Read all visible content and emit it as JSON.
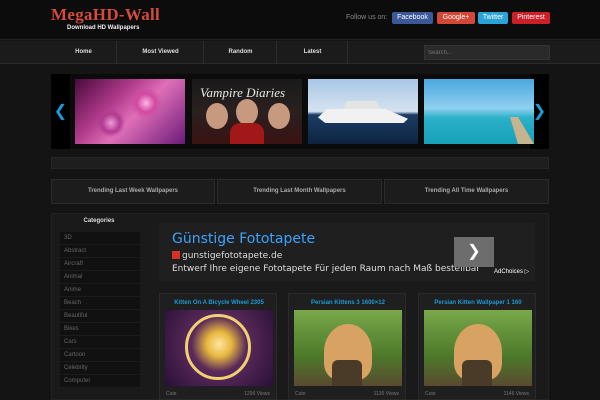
{
  "header": {
    "logo": "MegaHD-Wall",
    "tagline": "Download HD Wallpapers",
    "follow_label": "Follow us on:",
    "social": [
      "Facebook",
      "Google+",
      "Twitter",
      "Pinterest"
    ]
  },
  "nav": {
    "items": [
      "Home",
      "Most Viewed",
      "Random",
      "Latest"
    ],
    "search_placeholder": "Search..."
  },
  "slider": {
    "prev": "❮",
    "next": "❯",
    "slides": [
      {
        "caption": ""
      },
      {
        "caption": "Vampire Diaries"
      },
      {
        "caption": ""
      },
      {
        "caption": ""
      }
    ]
  },
  "trending": [
    "Trending Last Week Wallpapers",
    "Trending Last Month Wallpapers",
    "Trending All Time Wallpapers"
  ],
  "sidebar": {
    "title": "Categories",
    "items": [
      "3D",
      "Abstract",
      "Aircraft",
      "Animal",
      "Anime",
      "Beach",
      "Beautiful",
      "Bikes",
      "Cars",
      "Cartoon",
      "Celebrity",
      "Computer"
    ]
  },
  "ad": {
    "title": "Günstige Fototapete",
    "url": "gunstigefototapete.de",
    "description": "Entwerf Ihre eigene Fototapete Für jeden Raum nach Maß bestellbar",
    "go": "❯",
    "adchoices": "AdChoices ▷"
  },
  "cards": [
    {
      "title": "Kitten On A Bicycle Wheel 2305",
      "footer_left": "Cute",
      "footer_right": "1296 Views"
    },
    {
      "title": "Persian Kittens 3 1600×12",
      "footer_left": "Cute",
      "footer_right": "1136 Views"
    },
    {
      "title": "Persian Kitten Wallpaper 1 160",
      "footer_left": "Cute",
      "footer_right": "1146 Views"
    }
  ]
}
